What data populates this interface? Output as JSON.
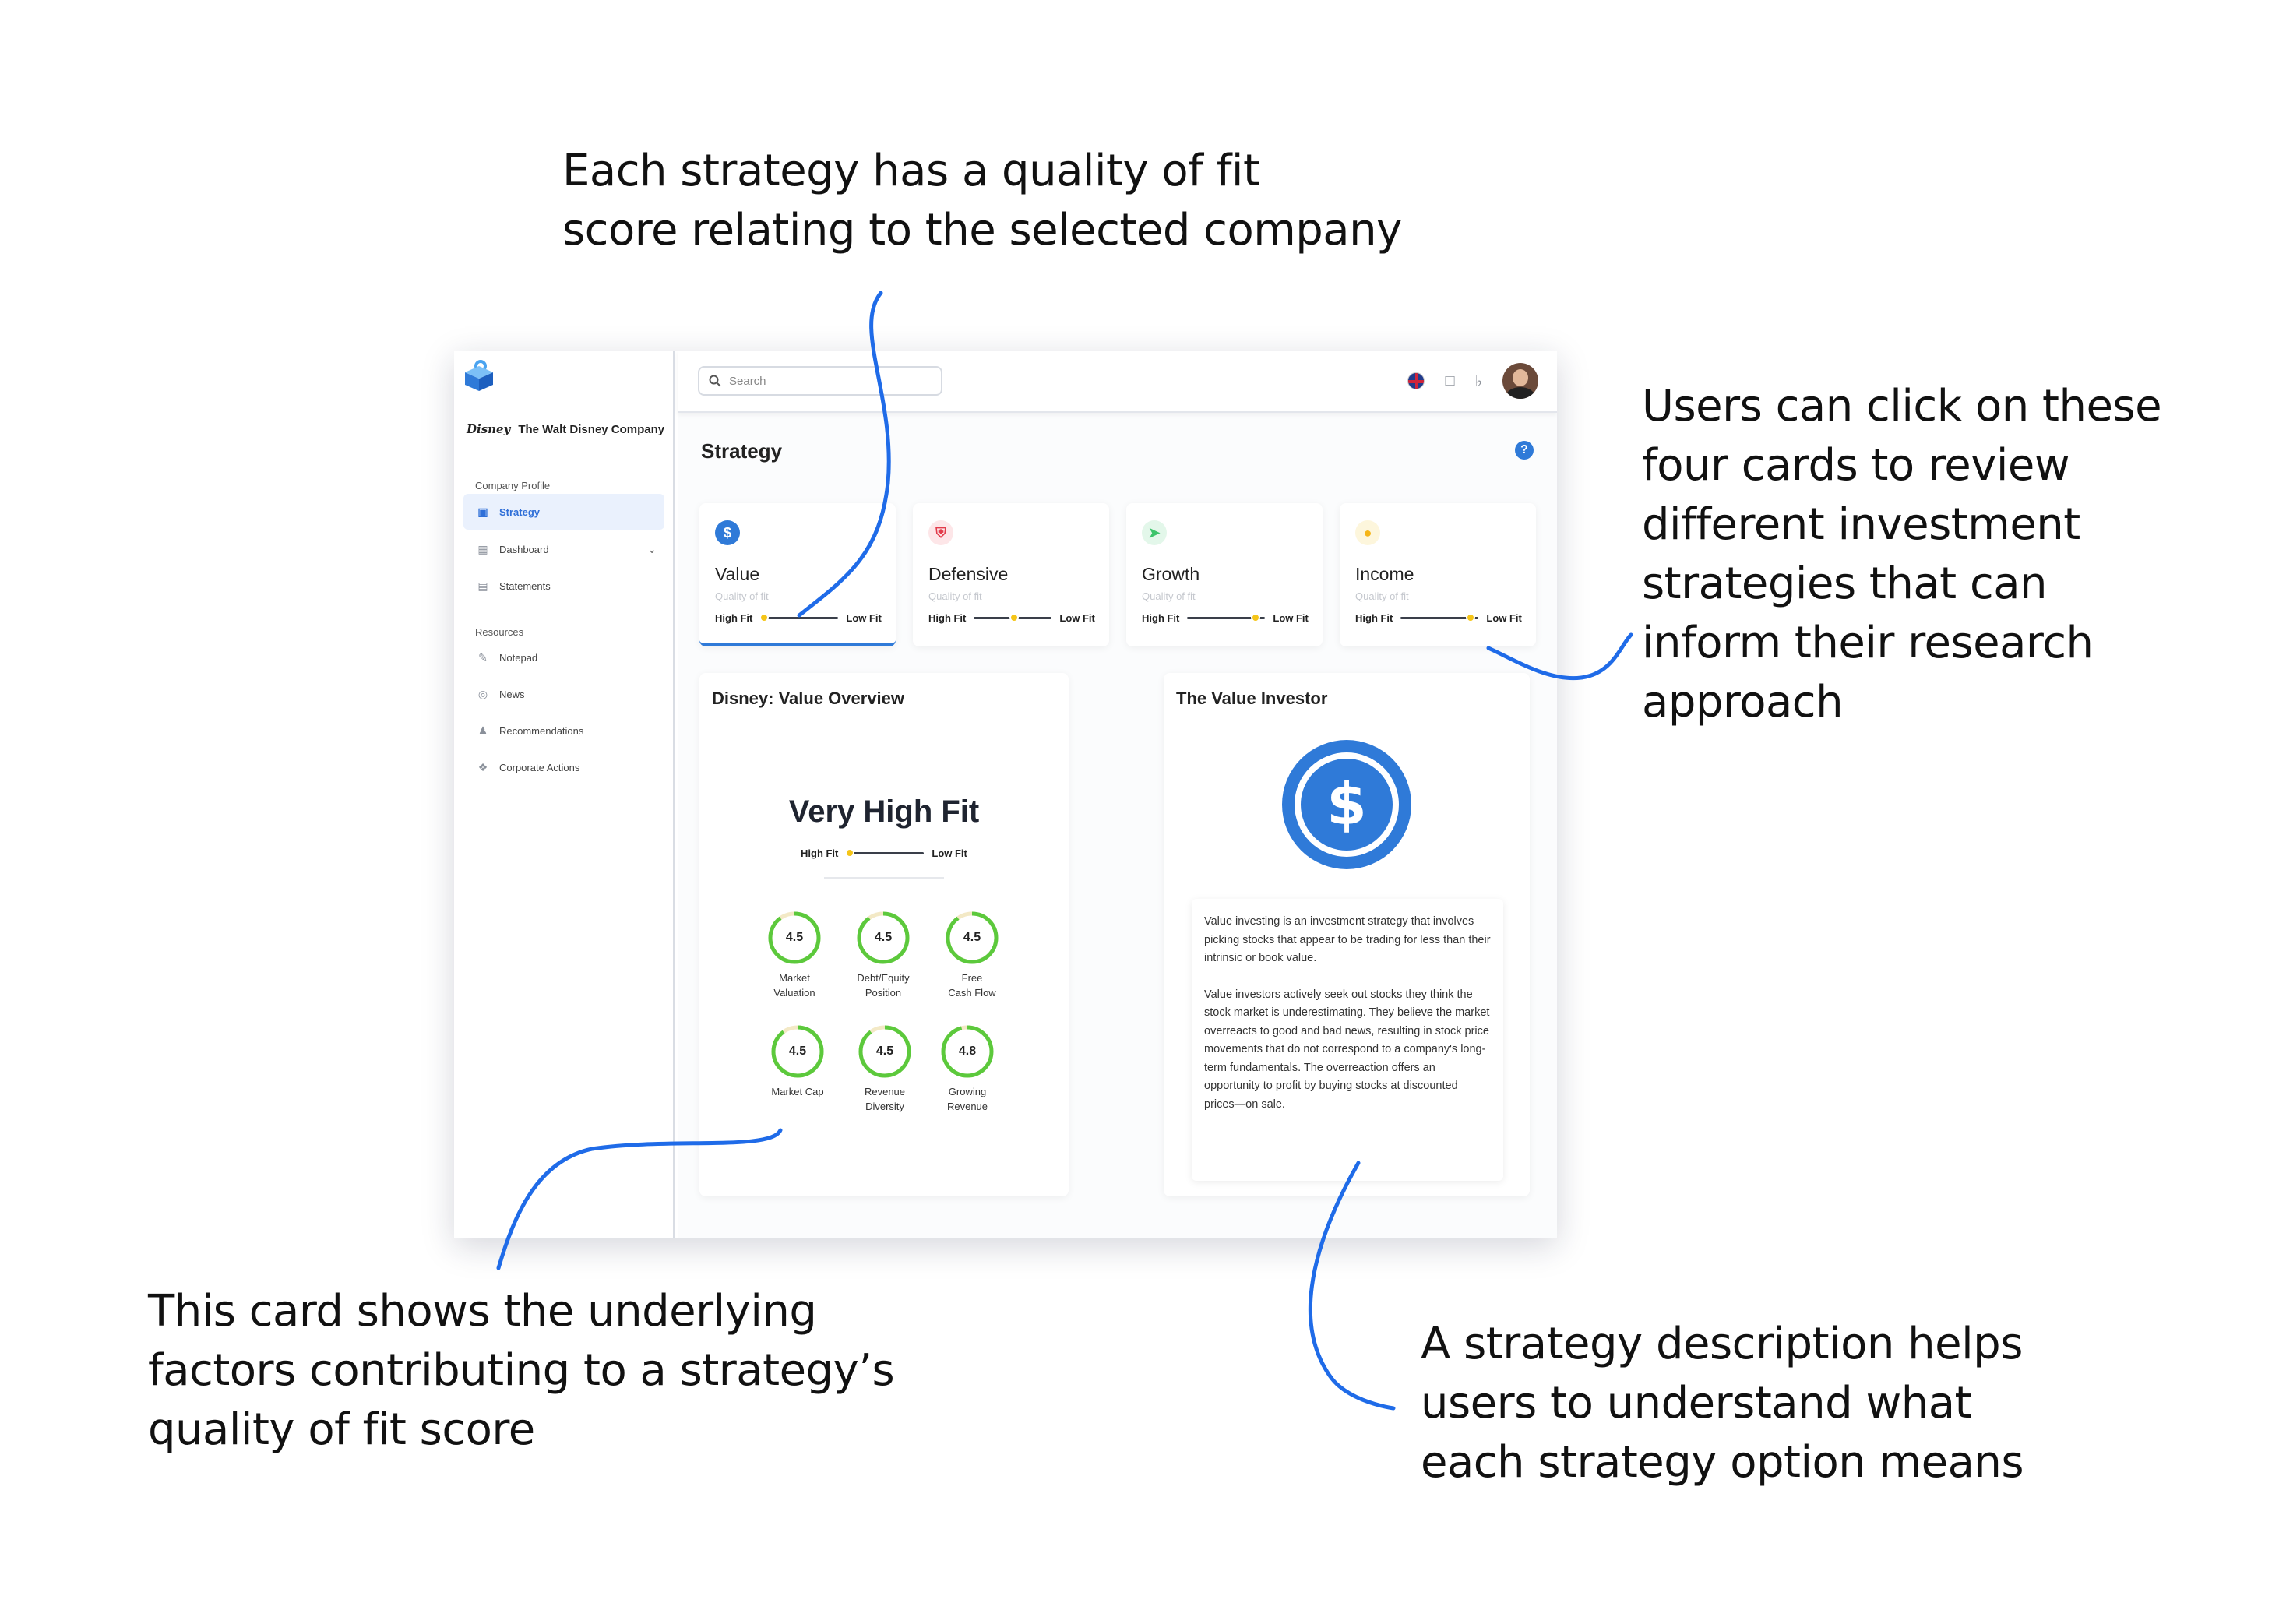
{
  "annotations": {
    "top": [
      "Each strategy has a quality of fit",
      "score relating to the selected company"
    ],
    "right": [
      "Users can click on these",
      "four cards to review",
      "different investment",
      "strategies that can",
      "inform their research",
      "approach"
    ],
    "bottom_left": [
      "This card shows the underlying",
      "factors contributing to a strategy’s",
      "quality of fit score"
    ],
    "bottom_right": [
      "A strategy description helps",
      "users to understand what",
      "each strategy option means"
    ],
    "connector_color": "#1f6be8"
  },
  "sidebar": {
    "company_logo_text": "Disney",
    "company_name": "The Walt Disney Company",
    "section_profile": "Company Profile",
    "section_resources": "Resources",
    "items": [
      {
        "label": "Strategy",
        "icon": "strategy-icon",
        "active": true
      },
      {
        "label": "Dashboard",
        "icon": "dashboard-icon"
      },
      {
        "label": "Statements",
        "icon": "statements-icon"
      },
      {
        "label": "Notepad",
        "icon": "notepad-icon"
      },
      {
        "label": "News",
        "icon": "globe-icon"
      },
      {
        "label": "Recommendations",
        "icon": "person-icon"
      },
      {
        "label": "Corporate Actions",
        "icon": "handshake-icon"
      }
    ]
  },
  "topbar": {
    "search_placeholder": "Search",
    "icons": [
      "uk-flag-icon",
      "chat-icon",
      "bell-icon",
      "avatar"
    ]
  },
  "page": {
    "title": "Strategy",
    "help": "?"
  },
  "strategy_cards": [
    {
      "name": "Value",
      "qof": "Quality of fit",
      "high": "High Fit",
      "low": "Low Fit",
      "fit_position": 0.05,
      "icon": "dollar-icon",
      "icon_color": "#2f7ad8",
      "selected": true
    },
    {
      "name": "Defensive",
      "qof": "Quality of fit",
      "high": "High Fit",
      "low": "Low Fit",
      "fit_position": 0.52,
      "icon": "shield-icon",
      "icon_color": "#e23b4a"
    },
    {
      "name": "Growth",
      "qof": "Quality of fit",
      "high": "High Fit",
      "low": "Low Fit",
      "fit_position": 0.88,
      "icon": "rocket-icon",
      "icon_color": "#3cc46a"
    },
    {
      "name": "Income",
      "qof": "Quality of fit",
      "high": "High Fit",
      "low": "Low Fit",
      "fit_position": 0.9,
      "icon": "piggy-bank-icon",
      "icon_color": "#f5c518"
    }
  ],
  "overview": {
    "title": "Disney: Value Overview",
    "fit_label": "Very High Fit",
    "high": "High Fit",
    "low": "Low Fit",
    "fit_position": 0.05,
    "factors": [
      {
        "value": "4.5",
        "label": "Market\nValuation",
        "score": 4.5
      },
      {
        "value": "4.5",
        "label": "Debt/Equity\nPosition",
        "score": 4.5
      },
      {
        "value": "4.5",
        "label": "Free\nCash Flow",
        "score": 4.5
      },
      {
        "value": "4.5",
        "label": "Market Cap",
        "score": 4.5
      },
      {
        "value": "4.5",
        "label": "Revenue\nDiversity",
        "score": 4.5
      },
      {
        "value": "4.8",
        "label": "Growing\nRevenue",
        "score": 4.8
      }
    ],
    "ring_color": "#5cc93c",
    "ring_track_color": "#f3e9c6"
  },
  "investor": {
    "title": "The Value Investor",
    "icon": "dollar-icon",
    "paragraphs": [
      "Value investing is an investment strategy that involves picking stocks that appear to be trading for less than their intrinsic or book value.",
      "Value investors actively seek out stocks they think the stock market is underestimating. They believe the market overreacts to good and bad news, resulting in stock price movements that do not correspond to a company's long-term fundamentals. The overreaction offers an opportunity to profit by buying stocks at discounted prices—on sale."
    ]
  }
}
